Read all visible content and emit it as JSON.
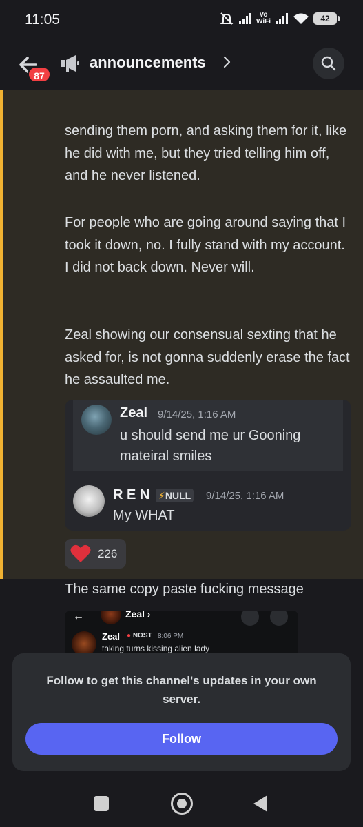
{
  "status_bar": {
    "time": "11:05",
    "vowifi_top": "Vo",
    "vowifi_bottom": "WiFi",
    "battery": "42"
  },
  "header": {
    "unread_count": "87",
    "channel_name": "announcements"
  },
  "message": {
    "paragraphs": [
      "sending them porn, and asking them for it, like he did with me, but they tried telling him off, and he never listened.",
      "For people who are going around saying that I took it down, no. I fully stand with my account. I did not back down. Never will.",
      "Zeal showing our consensual sexting that he asked for, is not gonna suddenly erase the fact he assaulted me."
    ]
  },
  "embed": {
    "quoted": {
      "author": "Zeal",
      "time": "9/14/25, 1:16 AM",
      "text": "u should send me ur Gooning mateiral smiles"
    },
    "reply": {
      "author": "R E N",
      "tag_icon": "⚡",
      "tag": "NULL",
      "time": "9/14/25, 1:16 AM",
      "text": "My WHAT"
    }
  },
  "reaction": {
    "icon": "heart-icon",
    "count": "226"
  },
  "next_message": {
    "text": "The same copy paste fucking message",
    "screenshot": {
      "header_name": "Zeal ›",
      "user": "Zeal",
      "tag": "NOST",
      "time": "8:06 PM",
      "text": "taking turns kissing alien lady"
    }
  },
  "follow_card": {
    "text": "Follow to get this channel's updates in your own server.",
    "button": "Follow"
  },
  "colors": {
    "accent": "#5865f2",
    "highlight_bar": "#f0b232",
    "badge": "#f23f43",
    "heart": "#e0303c"
  }
}
